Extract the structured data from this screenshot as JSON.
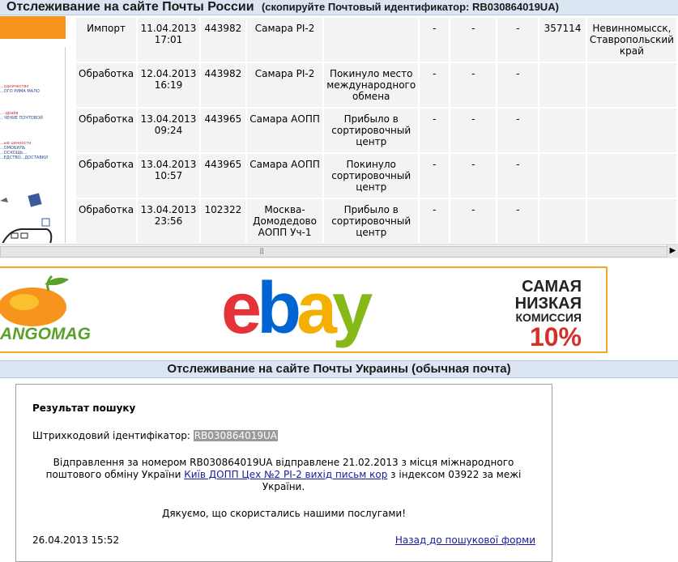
{
  "russia": {
    "title": "Отслеживание на сайте Почты России",
    "subtitle": "(скопируйте Почтовый идентификатор: RB030864019UA)",
    "rows": [
      {
        "op": "Импорт",
        "date": "11.04.2013",
        "time": "17:01",
        "index": "443982",
        "place": "Самара PI-2",
        "attr": "",
        "c6": "-",
        "c7": "-",
        "c8": "-",
        "dest_index": "357114",
        "dest": "Невинномысск, Ставропольский край"
      },
      {
        "op": "Обработка",
        "date": "12.04.2013",
        "time": "16:19",
        "index": "443982",
        "place": "Самара PI-2",
        "attr": "Покинуло место международного обмена",
        "c6": "-",
        "c7": "-",
        "c8": "-",
        "dest_index": "",
        "dest": ""
      },
      {
        "op": "Обработка",
        "date": "13.04.2013",
        "time": "09:24",
        "index": "443965",
        "place": "Самара АОПП",
        "attr": "Прибыло в сортировочный центр",
        "c6": "-",
        "c7": "-",
        "c8": "-",
        "dest_index": "",
        "dest": ""
      },
      {
        "op": "Обработка",
        "date": "13.04.2013",
        "time": "10:57",
        "index": "443965",
        "place": "Самара АОПП",
        "attr": "Покинуло сортировочный центр",
        "c6": "-",
        "c7": "-",
        "c8": "-",
        "dest_index": "",
        "dest": ""
      },
      {
        "op": "Обработка",
        "date": "13.04.2013",
        "time": "23:56",
        "index": "102322",
        "place": "Москва-Домодедово АОПП Уч-1",
        "attr": "Прибыло в сортировочный центр",
        "c6": "-",
        "c7": "-",
        "c8": "-",
        "dest_index": "",
        "dest": ""
      }
    ]
  },
  "left_ad": {
    "lines": [
      "...удничество",
      "...ОГО РИМА МАЛО",
      "...-драйв",
      "...ЧЕНИЕ ПОЧТОВОЙ",
      "...ые ценности",
      "...ОМОБИЛЬ",
      "...ОСКОЩЬ...",
      "...ЕДСТВО...ДОСТАВКИ"
    ]
  },
  "banner": {
    "mango_text": "ANGOMAG",
    "ebay": [
      "e",
      "b",
      "a",
      "y"
    ],
    "promo": [
      "САМАЯ",
      "НИЗКАЯ",
      "КОМИССИЯ",
      "10%"
    ]
  },
  "ukraine": {
    "title": "Отслеживание на сайте Почты Украины (обычная почта)",
    "result_title": "Результат пошуку",
    "barcode_label": "Штрихкодовий ідентифікатор:",
    "barcode_value": "RB030864019UA",
    "msg_part1": "Відправлення за номером RB030864019UA відправлене 21.02.2013 з місця міжнародного поштового обміну України ",
    "msg_link": "Київ ДОПП Цех №2 PI-2 вихід письм кор",
    "msg_part2": " з індексом 03922 за межі України.",
    "thanks": "Дякуємо, що скористались нашими послугами!",
    "datetime": "26.04.2013 15:52",
    "back_link": "Назад до пошукової форми"
  },
  "colors": {
    "header_bg": "#dce6f2",
    "orange": "#f7941d",
    "cell_bg": "#f3f3f3",
    "link": "#1a1a9c"
  }
}
